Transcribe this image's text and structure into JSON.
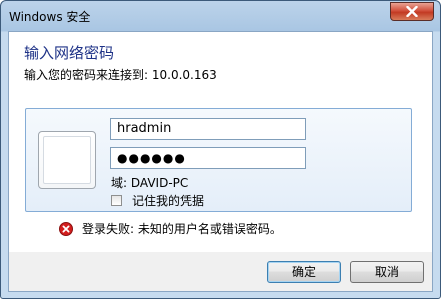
{
  "window": {
    "title": "Windows 安全",
    "close_icon": "close-x-icon"
  },
  "dialog": {
    "heading": "输入网络密码",
    "subheading": "输入您的密码来连接到: 10.0.0.163"
  },
  "credentials": {
    "username_value": "hradmin",
    "password_masked": "●●●●●●",
    "domain_text": "域: DAVID-PC",
    "remember_label": "记住我的凭据",
    "remember_checked": false
  },
  "error": {
    "message": "登录失败: 未知的用户名或错误密码。",
    "icon": "error-icon",
    "color": "#d21e1e"
  },
  "buttons": {
    "ok_label": "确定",
    "cancel_label": "取消"
  },
  "colors": {
    "heading": "#1e3287",
    "titlebar": "#a9c6e3",
    "close": "#c23a23"
  }
}
